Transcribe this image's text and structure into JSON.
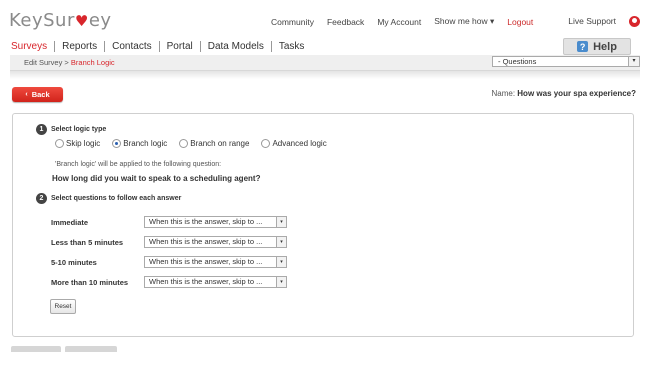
{
  "header": {
    "logo_text_a": "KeySur",
    "logo_heart": "♥",
    "logo_text_b": "ey",
    "links": {
      "community": "Community",
      "feedback": "Feedback",
      "my_account": "My Account",
      "show_me_how": "Show me how ▾",
      "logout": "Logout",
      "live_support": "Live Support"
    }
  },
  "nav": {
    "surveys": "Surveys",
    "reports": "Reports",
    "contacts": "Contacts",
    "portal": "Portal",
    "data_models": "Data Models",
    "tasks": "Tasks"
  },
  "help": {
    "icon": "?",
    "label": "Help"
  },
  "breadcrumb": {
    "prefix": "Edit Survey > ",
    "current": "Branch Logic"
  },
  "question_select": {
    "value": "- Questions",
    "caret": "▾"
  },
  "back_button": {
    "chevron": "‹",
    "label": "Back"
  },
  "survey": {
    "name_label": "Name: ",
    "name": "How was your spa experience?"
  },
  "step1": {
    "number": "1",
    "title": "Select logic type",
    "options": [
      "Skip logic",
      "Branch logic",
      "Branch on range",
      "Advanced logic"
    ],
    "selected": "Branch logic"
  },
  "note": "'Branch logic' will be applied to the following question:",
  "question": "How long did you wait to speak to a scheduling agent?",
  "step2": {
    "number": "2",
    "title": "Select questions to follow each answer"
  },
  "answers": [
    {
      "label": "Immediate",
      "select": "When this is the answer, skip to ..."
    },
    {
      "label": "Less than 5 minutes",
      "select": "When this is the answer, skip to ..."
    },
    {
      "label": "5-10 minutes",
      "select": "When this is the answer, skip to ..."
    },
    {
      "label": "More than 10 minutes",
      "select": "When this is the answer, skip to ..."
    }
  ],
  "select_caret": "▾",
  "reset_label": "Reset",
  "colors": {
    "brand_red": "#d8262c",
    "radio_blue": "#2a5fb0",
    "help_blue": "#4a8ccd"
  },
  "icons": {
    "support": "support-icon",
    "help": "help-icon",
    "step": "step-number-icon"
  }
}
